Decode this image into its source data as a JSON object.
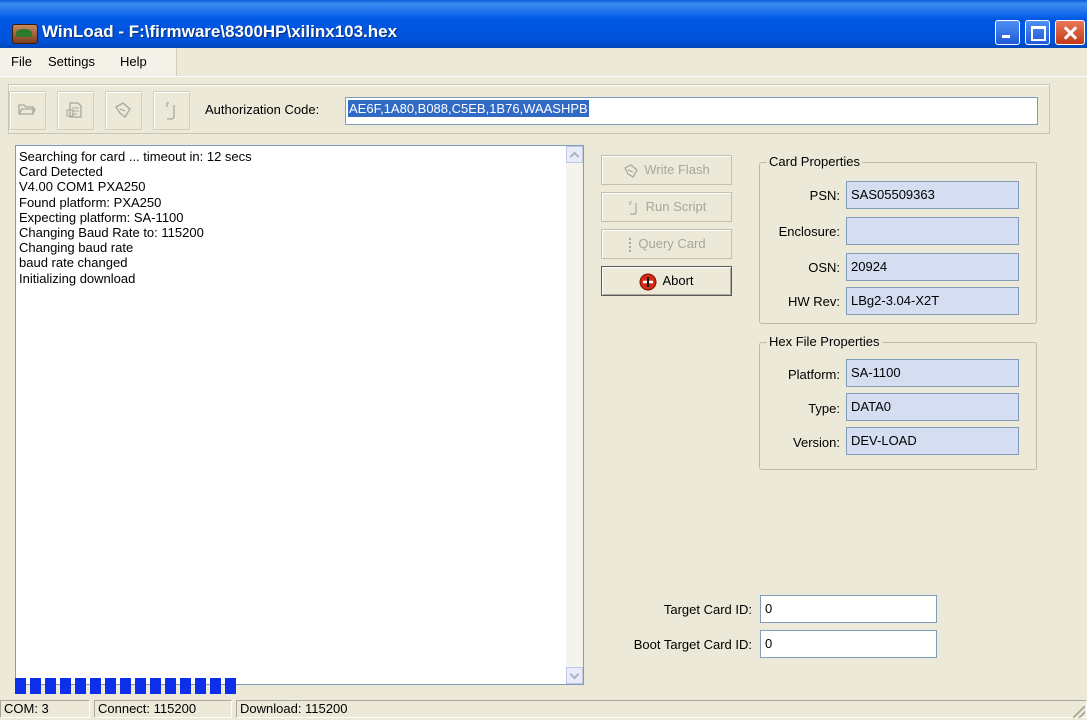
{
  "window": {
    "title": "WinLoad - F:\\firmware\\8300HP\\xilinx103.hex"
  },
  "menu": [
    "File",
    "Settings",
    "Help"
  ],
  "toolbar": {
    "buttons": [
      "open-icon",
      "document-icon",
      "write-flash-icon",
      "run-script-icon"
    ],
    "auth_label": "Authorization Code:",
    "auth_value": "AE6F,1A80,B088,C5EB,1B76,WAASHPB"
  },
  "log": [
    "Searching for card ... timeout in: 12 secs",
    "Card Detected",
    "V4.00 COM1 PXA250",
    "Found platform: PXA250",
    "Expecting platform: SA-1100",
    "Changing Baud Rate to: 115200",
    "Changing baud rate",
    "baud rate changed",
    "Initializing download"
  ],
  "actions": {
    "write_flash": "Write Flash",
    "run_script": "Run Script",
    "query_card": "Query Card",
    "abort": "Abort"
  },
  "card_properties": {
    "title": "Card Properties",
    "psn_label": "PSN:",
    "psn": "SAS05509363",
    "enclosure_label": "Enclosure:",
    "enclosure": "",
    "osn_label": "OSN:",
    "osn": "20924",
    "hwrev_label": "HW Rev:",
    "hwrev": "LBg2-3.04-X2T"
  },
  "hex_properties": {
    "title": "Hex File Properties",
    "platform_label": "Platform:",
    "platform": "SA-1100",
    "type_label": "Type:",
    "type": "DATA0",
    "version_label": "Version:",
    "version": "DEV-LOAD"
  },
  "target": {
    "target_label": "Target Card ID:",
    "target_value": "0",
    "boot_label": "Boot Target Card ID:",
    "boot_value": "0"
  },
  "progress": {
    "blocks_filled": 15,
    "bar_color": "#0D2EEA"
  },
  "status": {
    "com": "COM: 3",
    "connect": "Connect: 115200",
    "download": "Download: 115200"
  }
}
